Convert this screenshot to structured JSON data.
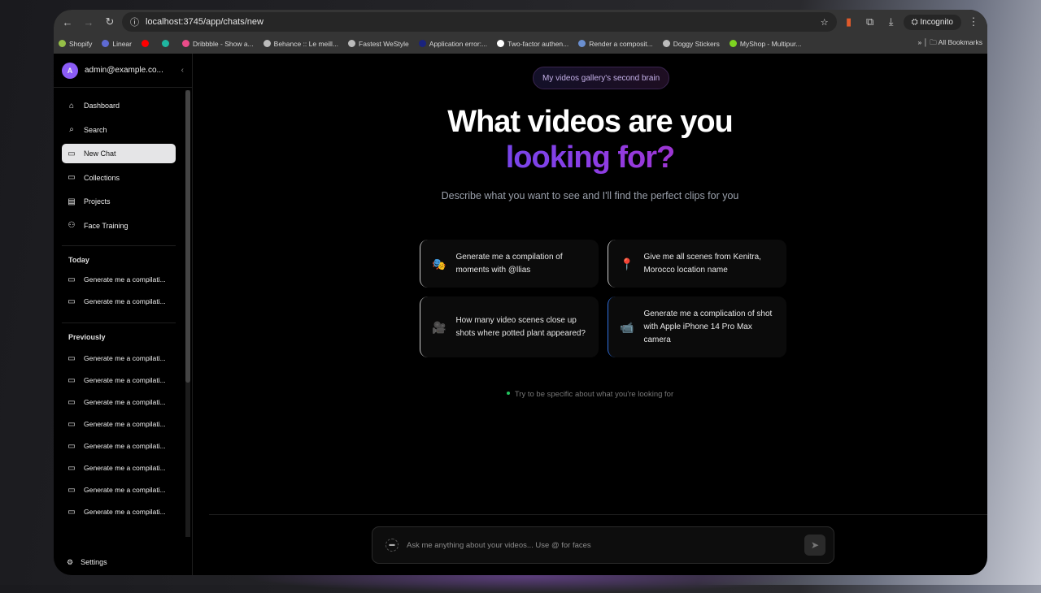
{
  "browser": {
    "url": "localhost:3745/app/chats/new",
    "incognito_label": "Incognito",
    "bookmarks": [
      {
        "label": "Shopify",
        "color": "#95bf47"
      },
      {
        "label": "Linear",
        "color": "#5e6ad2"
      },
      {
        "label": "",
        "color": "#ff0000"
      },
      {
        "label": "",
        "color": "#1fb5a0"
      },
      {
        "label": "Dribbble - Show a...",
        "color": "#ea4c89"
      },
      {
        "label": "Behance :: Le meill...",
        "color": "#bbbbbb"
      },
      {
        "label": "Fastest WeStyle",
        "color": "#bbbbbb"
      },
      {
        "label": "Application error:...",
        "color": "#1a237e"
      },
      {
        "label": "Two-factor authen...",
        "color": "#ffffff"
      },
      {
        "label": "Render a composit...",
        "color": "#6a8fd0"
      },
      {
        "label": "Doggy Stickers",
        "color": "#bbbbbb"
      },
      {
        "label": "MyShop - Multipur...",
        "color": "#7ed321"
      }
    ],
    "all_bookmarks": "All Bookmarks"
  },
  "sidebar": {
    "avatar_letter": "A",
    "account": "admin@example.co...",
    "nav": [
      {
        "label": "Dashboard",
        "icon": "home-icon",
        "glyph": "⌂"
      },
      {
        "label": "Search",
        "icon": "search-icon",
        "glyph": "⌕"
      },
      {
        "label": "New Chat",
        "icon": "chat-bubble-icon",
        "glyph": "▭",
        "active": true
      },
      {
        "label": "Collections",
        "icon": "folder-icon",
        "glyph": "▭"
      },
      {
        "label": "Projects",
        "icon": "film-icon",
        "glyph": "▤"
      },
      {
        "label": "Face Training",
        "icon": "users-icon",
        "glyph": "⚇"
      }
    ],
    "today_label": "Today",
    "today": [
      "Generate me a compilati...",
      "Generate me a compilati..."
    ],
    "previously_label": "Previously",
    "previously": [
      "Generate me a compilati...",
      "Generate me a compilati...",
      "Generate me a compilati...",
      "Generate me a compilati...",
      "Generate me a compilati...",
      "Generate me a compilati...",
      "Generate me a compilati...",
      "Generate me a compilati..."
    ],
    "settings": "Settings"
  },
  "main": {
    "badge": "My videos gallery's second brain",
    "title_line1": "What videos are you",
    "title_line2": "looking for?",
    "subtitle": "Describe what you want to see and I'll find the perfect clips for you",
    "suggestions": [
      {
        "emoji": "🎭",
        "text": "Generate me a compilation of moments with @llias"
      },
      {
        "emoji": "📍",
        "text": "Give me all scenes from Kenitra, Morocco location name"
      },
      {
        "emoji": "🎥",
        "text": "How many video scenes close up shots where potted plant appeared?"
      },
      {
        "emoji": "📹",
        "text": "Generate me a complication of shot with Apple iPhone 14 Pro Max camera"
      }
    ],
    "tip": "Try to be specific about what you're looking for",
    "input_placeholder": "Ask me anything about your videos... Use @ for faces"
  },
  "colors": {
    "accent_start": "#2f5cf5",
    "accent_end": "#e0158a",
    "tip_dot": "#22c55e",
    "avatar": "#8b5cf6"
  }
}
